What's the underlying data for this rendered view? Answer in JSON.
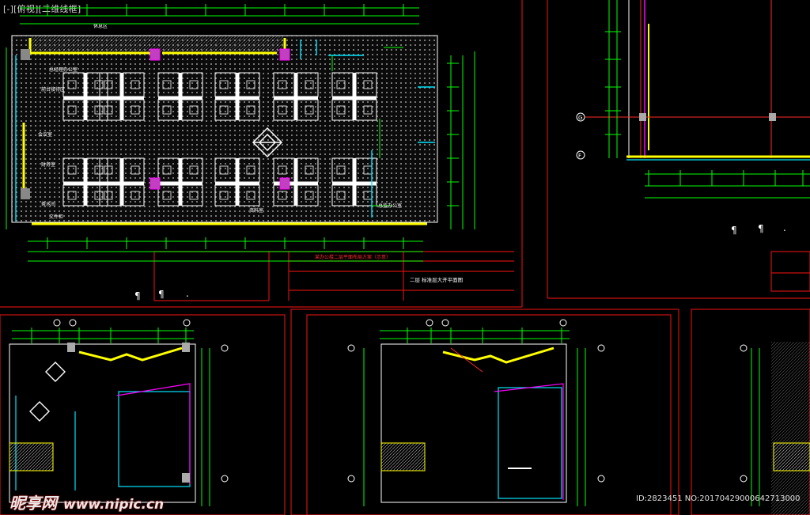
{
  "viewport": {
    "label": "[-][俯视][二维线框]"
  },
  "drawing": {
    "plan_title": "二层  标准层大开平面图",
    "header_note": "某办公楼二层平面布局方案（示意）",
    "room_labels": [
      "总经理办公室",
      "前台接待区",
      "会议室",
      "财务室",
      "茶水间",
      "文件柜",
      "资料室",
      "总监办公室",
      "休息区"
    ],
    "grid_bubbles": [
      "G",
      "F"
    ]
  },
  "colors": {
    "wall": "#ffffff",
    "dim": "#00ff00",
    "frame": "#ff2a2a",
    "cyan": "#00e5ff",
    "yellow": "#ffff00",
    "magenta": "#ff00ff"
  },
  "watermark": {
    "site_name": "昵享网",
    "url": "www.nipic.cn",
    "id_text": "ID:2823451 NO:20170429000642713000"
  }
}
